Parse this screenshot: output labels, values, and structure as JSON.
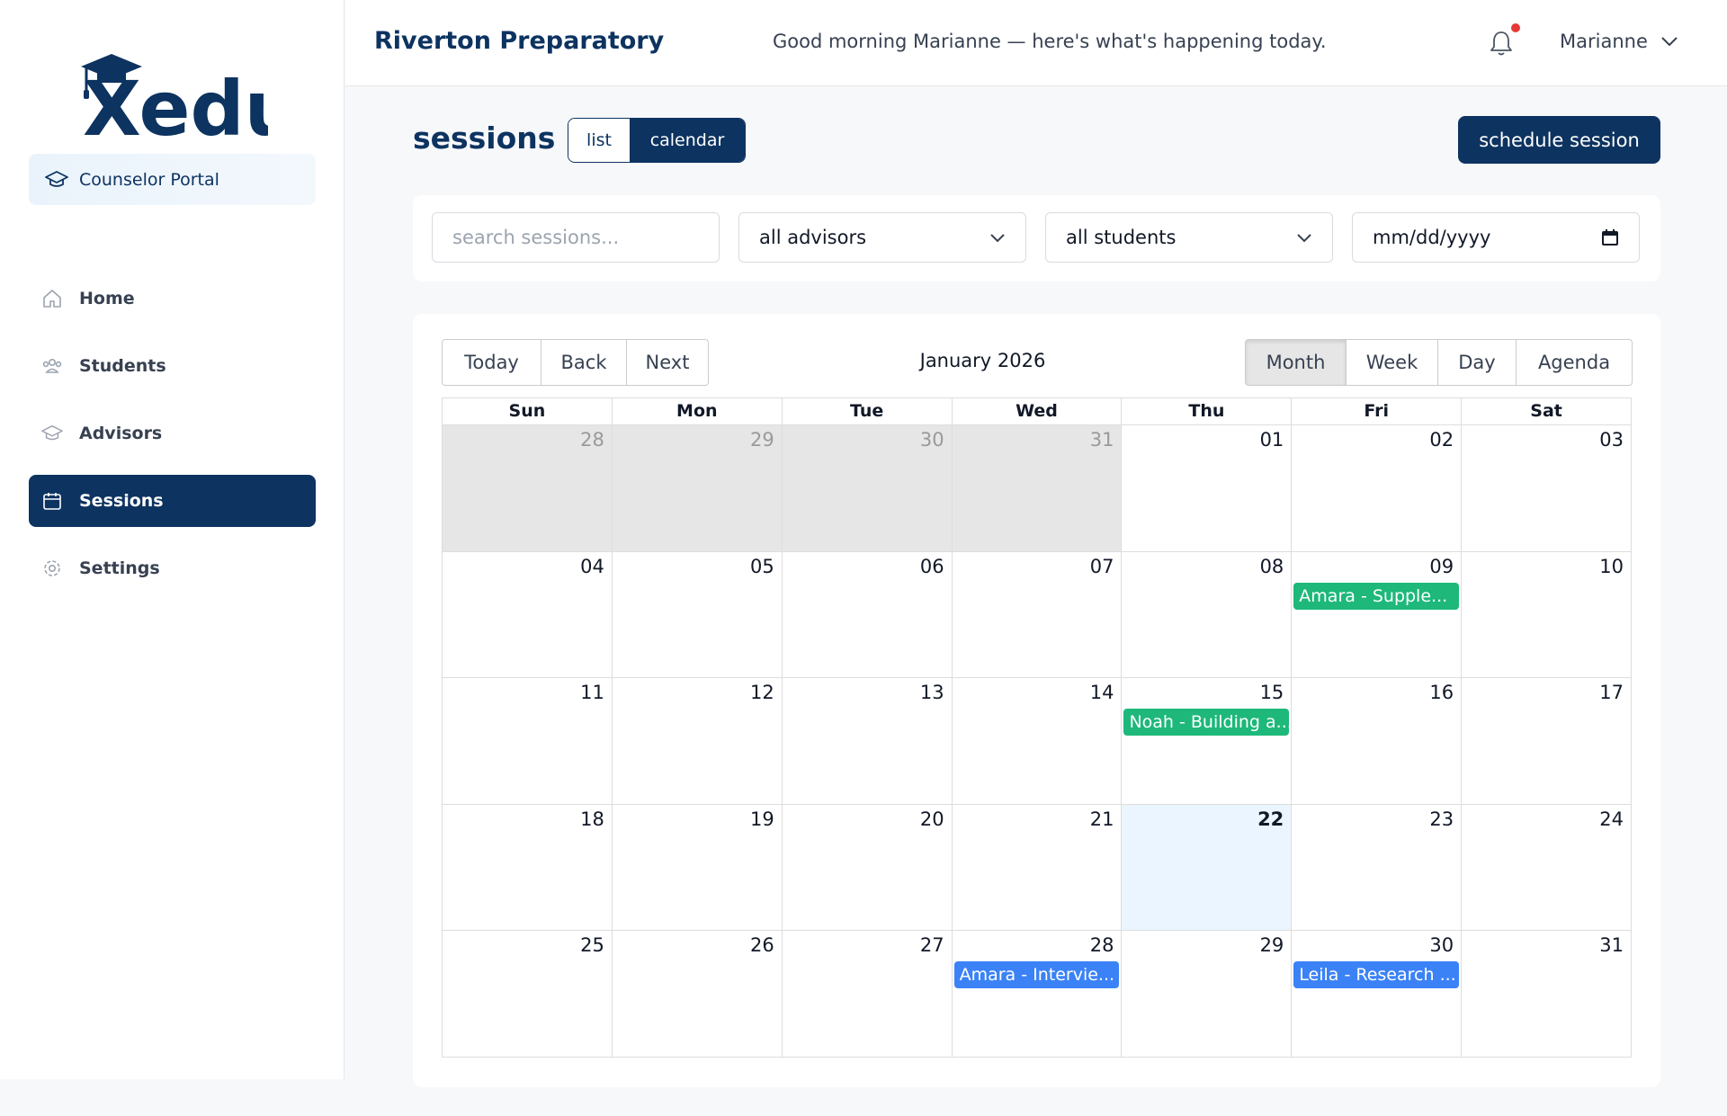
{
  "brand": {
    "logo_text": "Xedu",
    "portal_label": "Counselor Portal"
  },
  "sidebar": {
    "items": [
      {
        "label": "Home",
        "icon": "home-icon",
        "active": false
      },
      {
        "label": "Students",
        "icon": "users-icon",
        "active": false
      },
      {
        "label": "Advisors",
        "icon": "graduation-cap-icon",
        "active": false
      },
      {
        "label": "Sessions",
        "icon": "calendar-icon",
        "active": true
      },
      {
        "label": "Settings",
        "icon": "gear-icon",
        "active": false
      }
    ]
  },
  "header": {
    "school": "Riverton Preparatory",
    "greeting": "Good morning Marianne — here's what's happening today.",
    "user": "Marianne",
    "notification_indicator": true
  },
  "page": {
    "title": "sessions",
    "toggle": {
      "list": "list",
      "calendar": "calendar",
      "selected": "calendar"
    },
    "schedule_button": "schedule session"
  },
  "filters": {
    "search_placeholder": "search sessions...",
    "advisor": "all advisors",
    "student": "all students",
    "date_placeholder": "mm/dd/yyyy"
  },
  "calendar": {
    "nav": {
      "today": "Today",
      "back": "Back",
      "next": "Next"
    },
    "label": "January 2026",
    "views": {
      "month": "Month",
      "week": "Week",
      "day": "Day",
      "agenda": "Agenda",
      "selected": "Month"
    },
    "weekdays": [
      "Sun",
      "Mon",
      "Tue",
      "Wed",
      "Thu",
      "Fri",
      "Sat"
    ],
    "weeks": [
      [
        {
          "n": "28",
          "off": true
        },
        {
          "n": "29",
          "off": true
        },
        {
          "n": "30",
          "off": true
        },
        {
          "n": "31",
          "off": true
        },
        {
          "n": "01"
        },
        {
          "n": "02"
        },
        {
          "n": "03"
        }
      ],
      [
        {
          "n": "04"
        },
        {
          "n": "05"
        },
        {
          "n": "06"
        },
        {
          "n": "07"
        },
        {
          "n": "08"
        },
        {
          "n": "09",
          "event": {
            "title": "Amara - Supple...",
            "color": "#1db87a"
          }
        },
        {
          "n": "10"
        }
      ],
      [
        {
          "n": "11"
        },
        {
          "n": "12"
        },
        {
          "n": "13"
        },
        {
          "n": "14"
        },
        {
          "n": "15",
          "event": {
            "title": "Noah - Building a...",
            "color": "#1db87a"
          }
        },
        {
          "n": "16"
        },
        {
          "n": "17"
        }
      ],
      [
        {
          "n": "18"
        },
        {
          "n": "19"
        },
        {
          "n": "20"
        },
        {
          "n": "21"
        },
        {
          "n": "22",
          "today": true
        },
        {
          "n": "23"
        },
        {
          "n": "24"
        }
      ],
      [
        {
          "n": "25"
        },
        {
          "n": "26"
        },
        {
          "n": "27"
        },
        {
          "n": "28",
          "event": {
            "title": "Amara - Intervie...",
            "color": "#3b82f6"
          }
        },
        {
          "n": "29"
        },
        {
          "n": "30",
          "event": {
            "title": "Leila - Research ...",
            "color": "#3b82f6"
          }
        },
        {
          "n": "31"
        }
      ]
    ]
  },
  "colors": {
    "brand_navy": "#0d3360",
    "event_green": "#1db87a",
    "event_blue": "#3b82f6",
    "today_highlight": "#eaf5ff",
    "notification_dot": "#e53935"
  }
}
